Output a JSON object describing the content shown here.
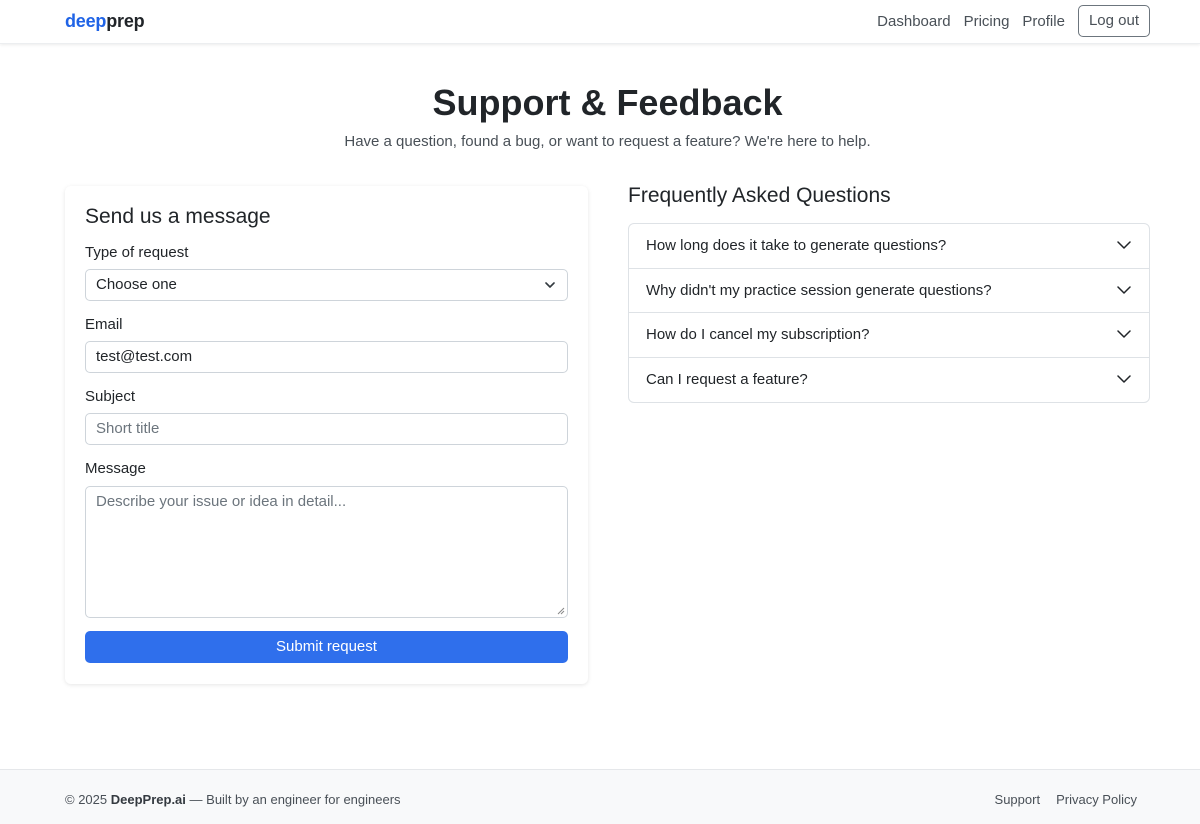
{
  "navbar": {
    "brand_part1": "deep",
    "brand_part2": "prep",
    "links": [
      "Dashboard",
      "Pricing",
      "Profile"
    ],
    "logout_label": "Log out"
  },
  "hero": {
    "title": "Support & Feedback",
    "subtitle": "Have a question, found a bug, or want to request a feature? We're here to help."
  },
  "form": {
    "title": "Send us a message",
    "type_label": "Type of request",
    "type_value": "Choose one",
    "email_label": "Email",
    "email_value": "test@test.com",
    "subject_label": "Subject",
    "subject_placeholder": "Short title",
    "message_label": "Message",
    "message_placeholder": "Describe your issue or idea in detail...",
    "submit_label": "Submit request"
  },
  "faq": {
    "title": "Frequently Asked Questions",
    "items": [
      "How long does it take to generate questions?",
      "Why didn't my practice session generate questions?",
      "How do I cancel my subscription?",
      "Can I request a feature?"
    ]
  },
  "footer": {
    "copyright": "© 2025",
    "brand": "DeepPrep.ai",
    "tagline": "— Built by an engineer for engineers",
    "links": [
      "Support",
      "Privacy Policy"
    ]
  },
  "colors": {
    "accent": "#2f6fec",
    "brand_blue": "#1f63e6"
  },
  "icons": [
    "chevron-down-icon",
    "resize-grip-icon"
  ]
}
